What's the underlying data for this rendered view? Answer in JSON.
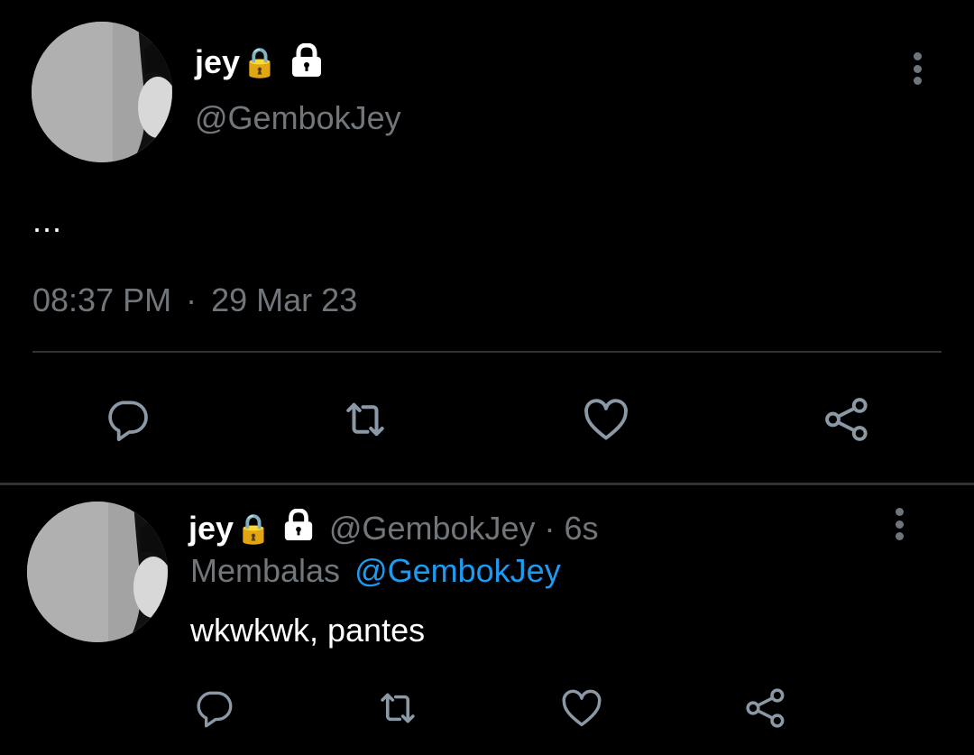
{
  "colors": {
    "background": "#000000",
    "text": "#ffffff",
    "muted": "#71767b",
    "link": "#1d9bf0",
    "divider": "#2f3336",
    "icon": "#8b98a5"
  },
  "main_tweet": {
    "display_name": "jey",
    "name_emoji": "🔒",
    "protected_icon": "lock-icon",
    "handle": "@GembokJey",
    "text": "...",
    "time": "08:37 PM",
    "separator": "·",
    "date": "29 Mar 23",
    "actions": [
      "reply-icon",
      "retweet-icon",
      "like-icon",
      "share-icon"
    ]
  },
  "reply_tweet": {
    "display_name": "jey",
    "name_emoji": "🔒",
    "protected_icon": "lock-icon",
    "handle": "@GembokJey",
    "separator": "·",
    "time_ago": "6s",
    "replying_prefix": "Membalas",
    "replying_to": "@GembokJey",
    "text": "wkwkwk, pantes",
    "actions": [
      "reply-icon",
      "retweet-icon",
      "like-icon",
      "share-icon"
    ]
  }
}
